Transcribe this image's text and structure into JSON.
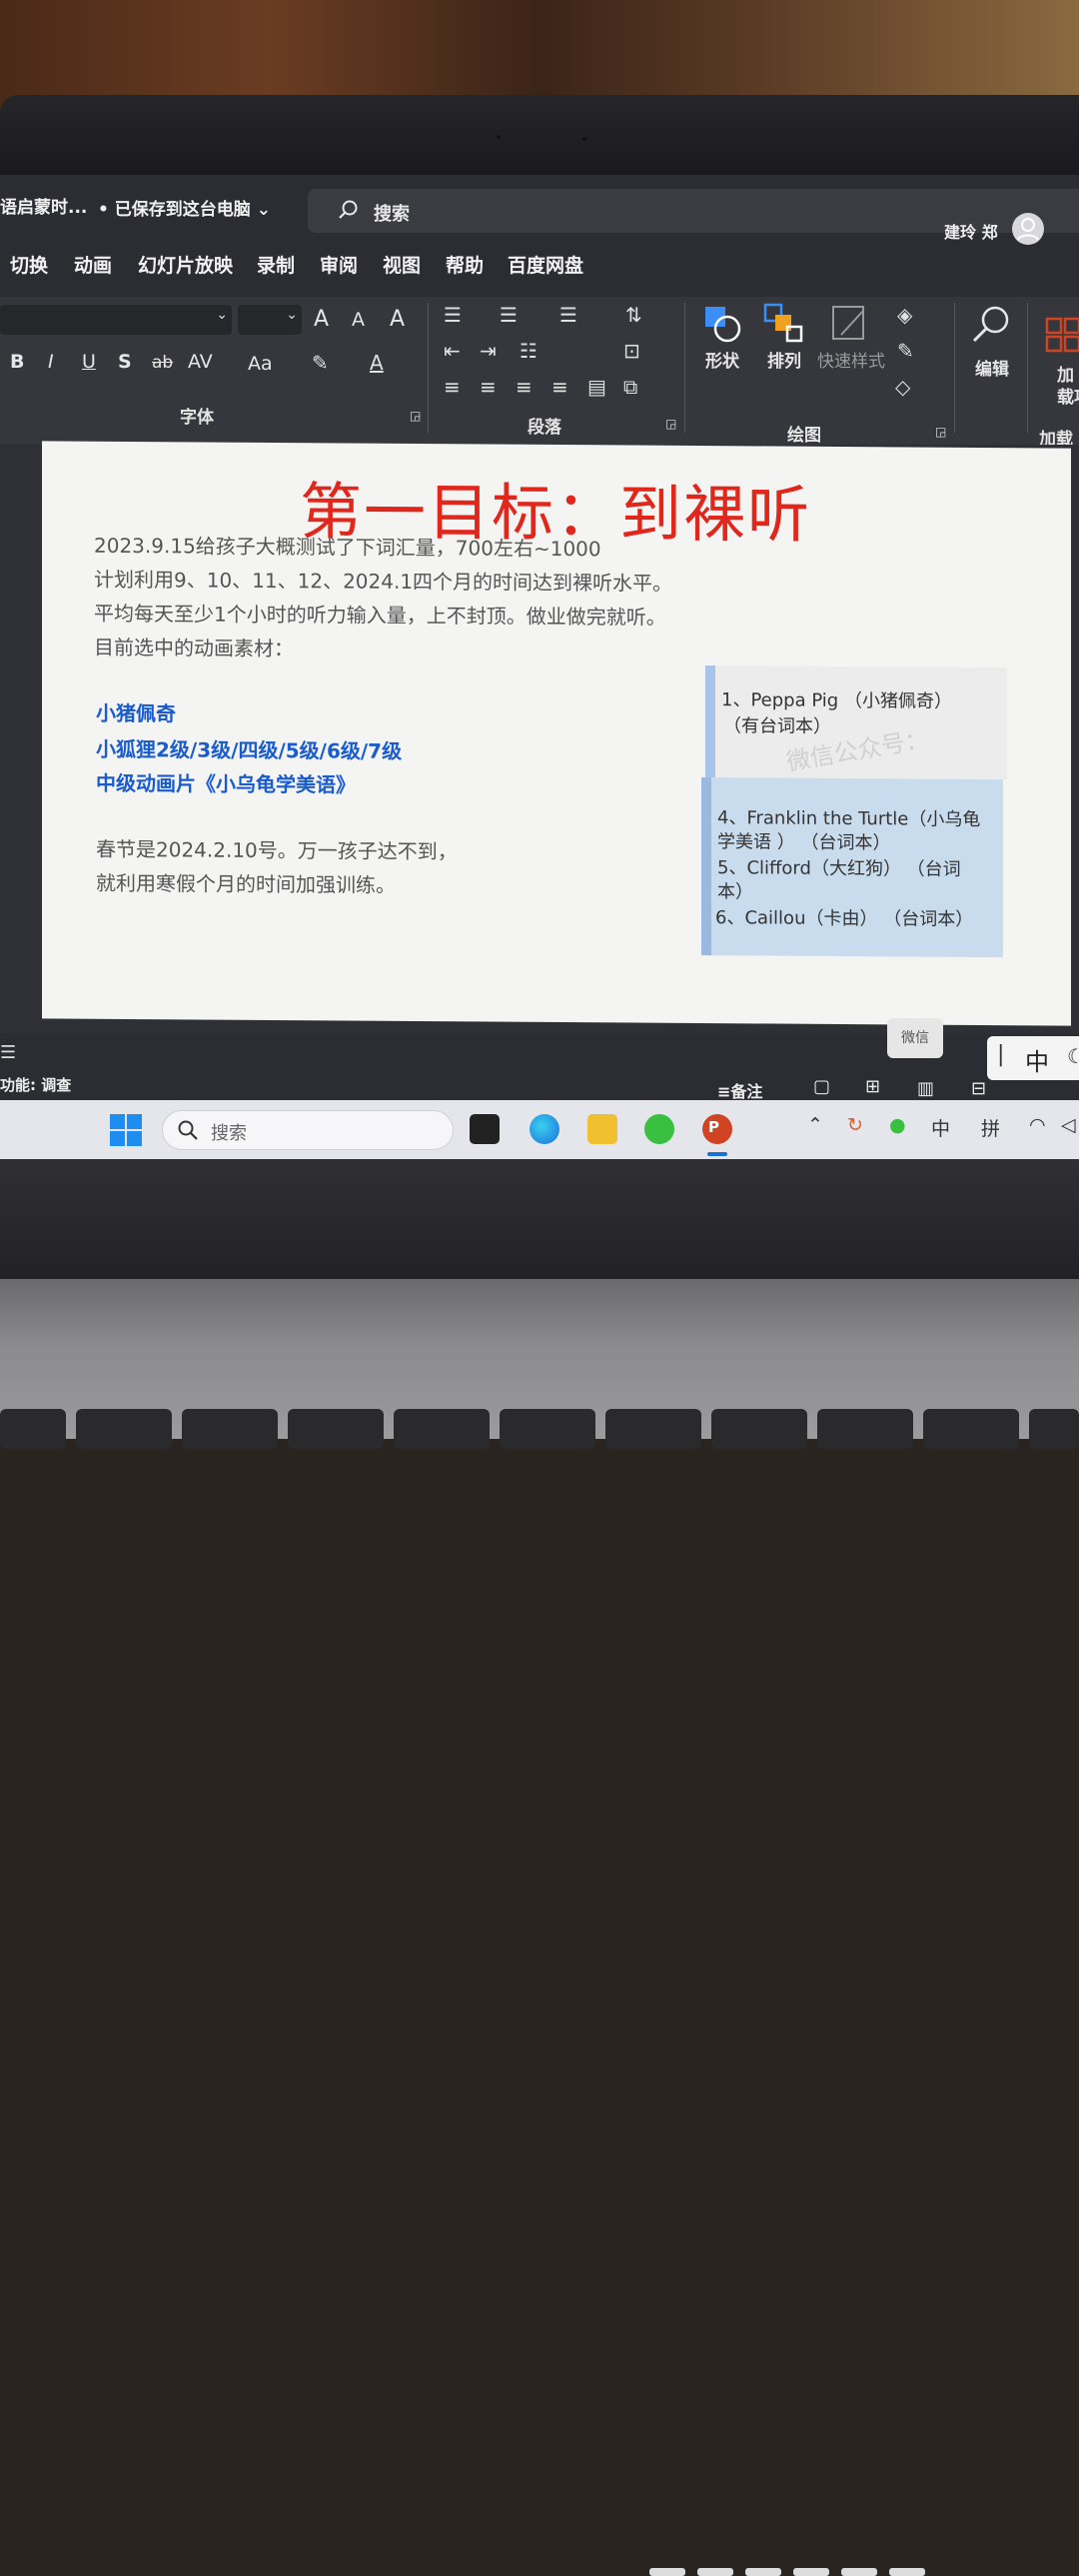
{
  "window": {
    "doc_name": "语启蒙时...",
    "save_status": "• 已保存到这台电脑",
    "search_placeholder": "搜索",
    "user_name": "建玲 郑"
  },
  "menu_tabs": [
    "切换",
    "动画",
    "幻灯片放映",
    "录制",
    "审阅",
    "视图",
    "帮助",
    "百度网盘"
  ],
  "ribbon": {
    "groups": {
      "font": "字体",
      "paragraph": "段落",
      "drawing": "绘图",
      "addins": "加载项"
    },
    "font_buttons": {
      "bold": "B",
      "italic": "I",
      "underline": "U",
      "shadow": "S",
      "strike": "ab",
      "spacing": "AV",
      "case": "Aa",
      "grow": "A",
      "shrink": "A",
      "clear": "A"
    },
    "draw_buttons": {
      "shape": "形状",
      "arrange": "排列",
      "quick_styles": "快速样式",
      "edit": "编辑",
      "addin": "加\n载项"
    }
  },
  "slide": {
    "title": "第一目标：到裸听",
    "lines": [
      "2023.9.15给孩子大概测试了下词汇量，700左右~1000",
      "计划利用9、10、11、12、2024.1四个月的时间达到裸听水平。",
      "平均每天至少1个小时的听力输入量，上不封顶。做业做完就听。",
      "目前选中的动画素材："
    ],
    "blue_items": [
      "小猪佩奇",
      "小狐狸2级/3级/四级/5级/6级/7级",
      "中级动画片《小乌龟学美语》"
    ],
    "footer_lines": [
      "春节是2024.2.10号。万一孩子达不到，",
      "就利用寒假个月的时间加强训练。"
    ],
    "card": {
      "top_lines": [
        "1、Peppa Pig （小猪佩奇）",
        "（有台词本）"
      ],
      "bottom_lines": [
        "4、Franklin the Turtle（小乌龟",
        "学美语 ） （台词本）",
        "5、Clifford（大红狗） （台词",
        "本）",
        "6、Caillou（卡由） （台词本）"
      ],
      "watermark": "微信公众号："
    }
  },
  "statusbar": {
    "left_text": "功能: 调查",
    "notes_label": "备注",
    "wechat_popup": "微信",
    "ime_mode": "中"
  },
  "taskbar": {
    "search_placeholder": "搜索",
    "tray_ime_1": "中",
    "tray_ime_2": "拼"
  },
  "colors": {
    "title_red": "#e1261c",
    "link_blue": "#1a5ccc",
    "ppt_orange": "#d04423",
    "ribbon_bg": "#35373d"
  }
}
